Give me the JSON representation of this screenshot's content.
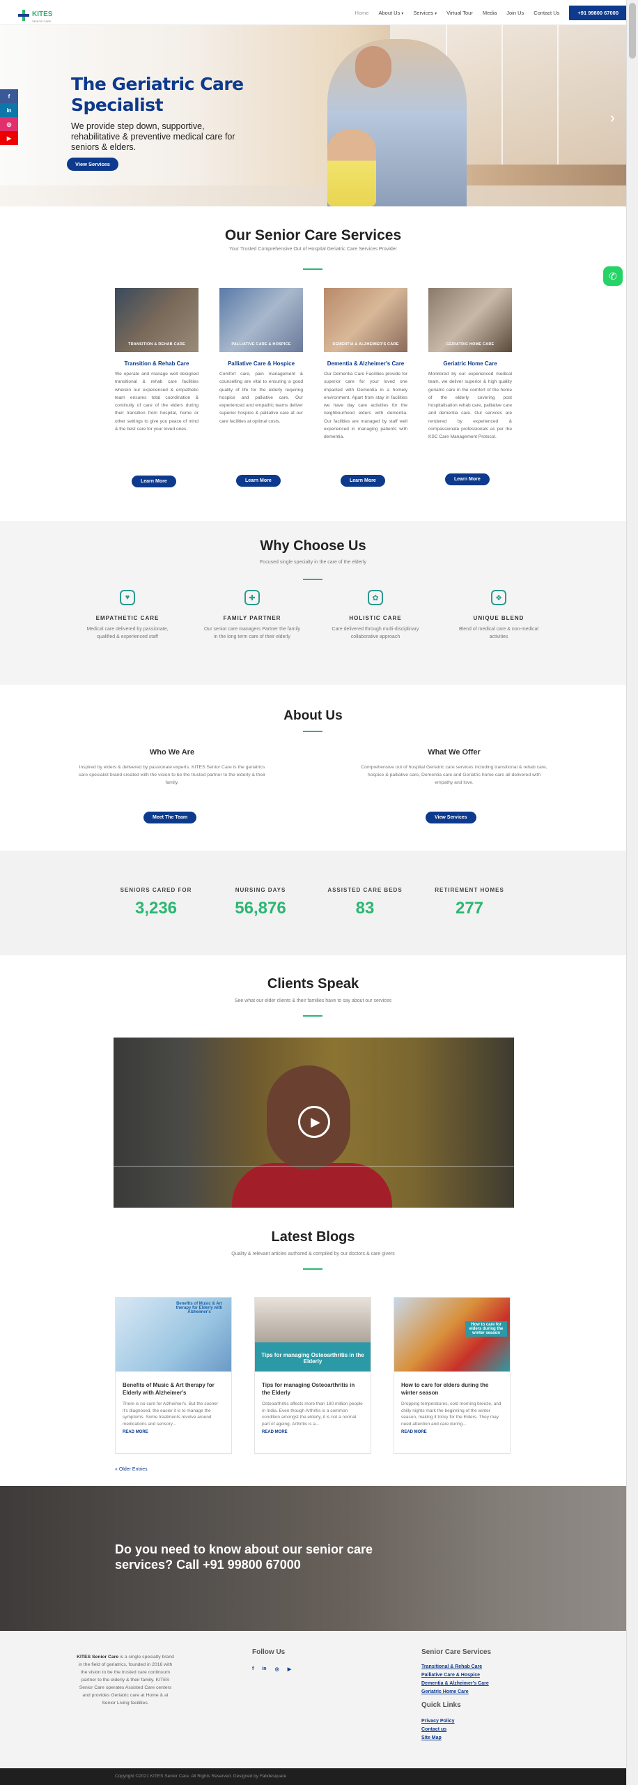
{
  "brand": {
    "name": "KITES",
    "tagline": "SENIOR CARE"
  },
  "nav": {
    "items": [
      {
        "label": "Home",
        "caret": ""
      },
      {
        "label": "About Us",
        "caret": "▾"
      },
      {
        "label": "Services",
        "caret": "▾"
      },
      {
        "label": "Virtual Tour",
        "caret": ""
      },
      {
        "label": "Media",
        "caret": ""
      },
      {
        "label": "Join Us",
        "caret": ""
      },
      {
        "label": "Contact Us",
        "caret": ""
      }
    ],
    "cta": "+91 99800 67000"
  },
  "hero": {
    "title": "The Geriatric Care Specialist",
    "subtitle": "We provide step down, supportive, rehabilitative & preventive medical care for seniors & elders.",
    "button": "View Services",
    "next_arrow": "›"
  },
  "social_side": [
    "f",
    "in",
    "◎",
    "▶"
  ],
  "services_section": {
    "title": "Our Senior Care Services",
    "subtitle": "Your Trusted Comprehensive Out of Hospital Geriatric Care Services Provider",
    "items": [
      {
        "caption": "TRANSITION & REHAB CARE",
        "heading": "Transition & Rehab Care",
        "text": "We operate and manage well designed transitional & rehab care facilities wherein our experienced & empathetic team ensures total coordination & continuity of care of the elders during their transition from hospital, home or other settings to give you peace of mind & the best care for your loved ones.",
        "button": "Learn More"
      },
      {
        "caption": "PALLIATIVE CARE & HOSPICE",
        "heading": "Palliative Care & Hospice",
        "text": "Comfort care, pain management & counselling are vital to ensuring a good quality of life for the elderly requiring hospice and palliative care. Our experienced and empathic teams deliver superior hospice & palliative care at our care facilities at optimal costs.",
        "button": "Learn More"
      },
      {
        "caption": "DEMENTIA & ALZHEIMER'S CARE",
        "heading": "Dementia & Alzheimer's Care",
        "text": "Our Dementia Care Facilities provide for superior care for your loved one impacted with Dementia in a homely environment. Apart from stay in facilities we have day care activities for the neighbourhood elders with dementia. Our facilities are managed by staff well experienced in managing patients with dementia.",
        "button": "Learn More"
      },
      {
        "caption": "GERIATRIC HOME CARE",
        "heading": "Geriatric Home Care",
        "text": "Monitored by our experienced medical team, we deliver superior & high quality geriatric care in the comfort of the home of the elderly covering post hospitalisation rehab care, palliative care and dementia care. Our services are rendered by experienced & compassionate professionals as per the KSC Care Management Protocol.",
        "button": "Learn More"
      }
    ]
  },
  "why_section": {
    "title": "Why Choose Us",
    "subtitle": "Focused single specialty in the care of the elderly",
    "items": [
      {
        "icon": "heart-hand-icon",
        "glyph": "♥",
        "heading": "EMPATHETIC CARE",
        "text": "Medical care delivered by passionate, qualified & experienced staff"
      },
      {
        "icon": "shield-heart-icon",
        "glyph": "✚",
        "heading": "FAMILY PARTNER",
        "text": "Our senior care managers Partner the family in the long term care of their elderly"
      },
      {
        "icon": "holistic-icon",
        "glyph": "✿",
        "heading": "HOLISTIC CARE",
        "text": "Care delivered through multi-disciplinary collaborative approach"
      },
      {
        "icon": "blend-icon",
        "glyph": "❖",
        "heading": "UNIQUE BLEND",
        "text": "Blend of medical care & non-medical activities"
      }
    ]
  },
  "about_section": {
    "title": "About Us",
    "who": {
      "heading": "Who We Are",
      "text": "Inspired by elders & delivered by passionate experts. KITES Senior Care is the geriatrics care specialist brand created with the vision to be the trusted partner to the elderly & their family.",
      "button": "Meet The Team"
    },
    "what": {
      "heading": "What We Offer",
      "text": "Comprehensive out of hospital Geriatric care services including transitional & rehab care, hospice & palliative care, Dementia care and Geriatric home care all delivered with empathy and love.",
      "button": "View Services"
    }
  },
  "stats": [
    {
      "label": "SENIORS CARED FOR",
      "value": "3,236"
    },
    {
      "label": "NURSING DAYS",
      "value": "56,876"
    },
    {
      "label": "ASSISTED CARE BEDS",
      "value": "83"
    },
    {
      "label": "RETIREMENT HOMES",
      "value": "277"
    }
  ],
  "clients_section": {
    "title": "Clients Speak",
    "subtitle": "See what our elder clients & their families have to say about our services",
    "play": "▶"
  },
  "blogs_section": {
    "title": "Latest Blogs",
    "subtitle": "Quality & relevant articles authored & compiled by our doctors & care givers",
    "posts": [
      {
        "image_caption": "Benefits of Music & Art therapy for Elderly with Alzheimer's",
        "title": "Benefits of Music & Art therapy for Elderly with Alzheimer's",
        "excerpt": "There is no cure for Alzheimer's. But the sooner it's diagnosed, the easier it is to manage the symptoms. Some treatments revolve around medications and sensory...",
        "more": "READ MORE"
      },
      {
        "image_caption": "Tips for managing Osteoarthritis in the Elderly",
        "title": "Tips for managing Osteoarthritis in the Elderly",
        "excerpt": "Osteoarthritis affects more than 180 million people in India. Even though Arthritis is a common condition amongst the elderly, it is not a normal part of ageing. Arthritis is a...",
        "more": "READ MORE"
      },
      {
        "image_caption": "How to care for elders during the winter season",
        "title": "How to care for elders during the winter season",
        "excerpt": "Dropping temperatures, cold morning breeze, and chilly nights mark the beginning of the winter season, making it tricky for the Elders. They may need attention and care during...",
        "more": "READ MORE"
      }
    ],
    "older": "« Older Entries"
  },
  "cta_band": {
    "text": "Do you need to know about our senior care services? Call +91 99800 67000"
  },
  "footer": {
    "about_brand": "KITES Senior Care",
    "about_text": " is a single specialty brand in the field of geriatrics, founded in 2016 with the vision to be the trusted care continuum partner to the elderly & their family. KITES Senior Care operates Assisted Care centers and provides Geriatric care at Home & at Senior Living facilities.",
    "follow_title": "Follow Us",
    "follow_icons": [
      "f",
      "in",
      "◎",
      "▶"
    ],
    "services_title": "Senior Care Services",
    "services_links": [
      "Transitional & Rehab Care",
      "Palliative Care & Hospice",
      "Dementia & Alzheimer's Care",
      "Geriatric Home Care"
    ],
    "quick_title": "Quick Links",
    "quick_links": [
      "Privacy Policy",
      "Contact us",
      "Site Map"
    ],
    "copyright": "Copyright ©2021 KITES Senior Care. All Rights Reserved. Designed by Fabdesquare"
  },
  "colors": {
    "primary": "#0d3a8c",
    "accent": "#2bb673",
    "whatsapp": "#25d366"
  }
}
